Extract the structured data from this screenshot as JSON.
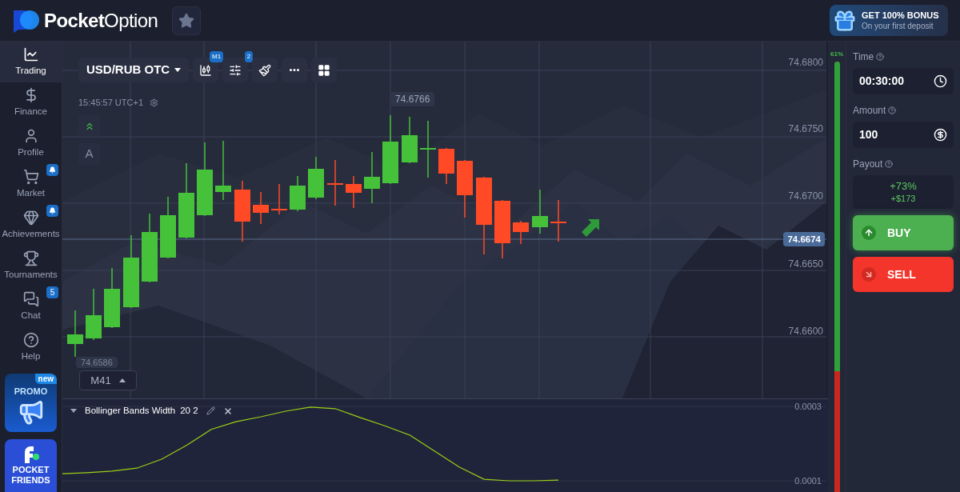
{
  "header": {
    "logo_text": "**Pocket**Option",
    "bonus": {
      "title": "GET 100% BONUS",
      "subtitle": "On your first deposit"
    }
  },
  "sidebar": {
    "items": [
      {
        "label": "Trading",
        "kind": "chart",
        "selected": true
      },
      {
        "label": "Finance",
        "kind": "dollar",
        "selected": false
      },
      {
        "label": "Profile",
        "kind": "user",
        "selected": false
      },
      {
        "label": "Market",
        "kind": "cart",
        "selected": false,
        "badge": {
          "kind": "bell"
        }
      },
      {
        "label": "Achievements",
        "kind": "gem",
        "selected": false,
        "badge": {
          "kind": "bell"
        }
      },
      {
        "label": "Tournaments",
        "kind": "trophy",
        "selected": false
      },
      {
        "label": "Chat",
        "kind": "chat",
        "selected": false,
        "badge": {
          "kind": "count",
          "text": "5"
        }
      },
      {
        "label": "Help",
        "kind": "help",
        "selected": false
      }
    ],
    "promo": {
      "label": "PROMO",
      "tag": "new"
    },
    "friends": {
      "label": "POCKET FRIENDS"
    }
  },
  "toolbar": {
    "asset": "USD/RUB OTC",
    "buttons": [
      {
        "kind": "candles",
        "badge": "M1"
      },
      {
        "kind": "sliders",
        "badge": "2"
      },
      {
        "kind": "brush"
      },
      {
        "kind": "more"
      },
      {
        "kind": "layout"
      }
    ]
  },
  "clock": "15:45:57 UTC+1",
  "side_tools": [
    {
      "kind": "arrows"
    },
    {
      "kind": "text",
      "text": "A"
    }
  ],
  "price_axis": [
    "74.6800",
    "74.6750",
    "74.6700",
    "74.6650",
    "74.6600"
  ],
  "current_price": "74.6674",
  "high_label": "74.6766",
  "low_label": "74.6586",
  "timeframe": "M41",
  "indicator": {
    "params": "20 2",
    "chart_data": {
      "type": "line",
      "categories": [
        null,
        null,
        null,
        null,
        null,
        null,
        null,
        null,
        null,
        null,
        null,
        null,
        null,
        null,
        null,
        null,
        null,
        null,
        null,
        null,
        null,
        null,
        null,
        null,
        null,
        null,
        null,
        null,
        null
      ],
      "ylim": [
        0.0001,
        0.0003
      ],
      "yticks": [
        {
          "value": 0.0003,
          "label": "0.0003"
        },
        {
          "value": 0.0001,
          "label": "0.0001"
        }
      ],
      "series": [
        {
          "name": "Bollinger Bands Width",
          "color": "#9ad014",
          "values": [
            0.000119,
            0.000122,
            0.000126,
            0.000134,
            0.000158,
            0.000195,
            0.000238,
            0.000259,
            0.000272,
            0.000287,
            0.000298,
            0.000294,
            0.00027,
            0.000248,
            0.000223,
            0.00018,
            0.000137,
            0.000104,
            0.0001,
            0.0001,
            0.000102,
            null,
            null,
            null,
            null,
            null,
            null,
            null,
            null
          ]
        }
      ]
    }
  },
  "sentiment": {
    "reading": "61%",
    "level": 0.72
  },
  "trade": {
    "time": {
      "label": "Time",
      "value": "00:30:00"
    },
    "amount": {
      "label": "Amount",
      "value": "100"
    },
    "payout": {
      "label": "Payout",
      "percent": "+73%",
      "profit": "+$173"
    },
    "buy": "BUY",
    "sell": "SELL"
  }
}
